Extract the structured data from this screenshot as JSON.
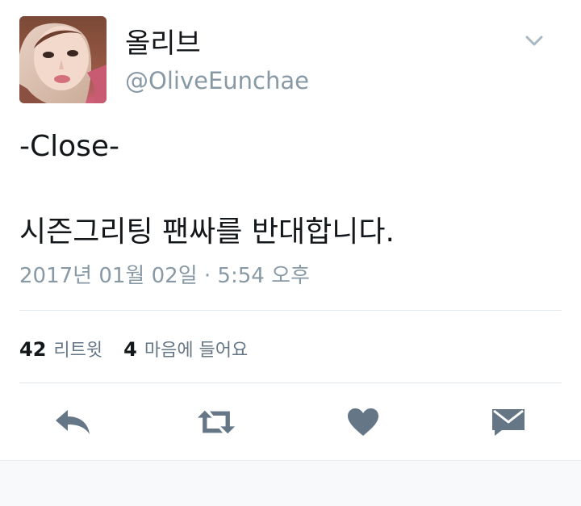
{
  "tweet": {
    "author": {
      "display_name": "올리브",
      "handle": "@OliveEunchae"
    },
    "text_lines": [
      "-Close-",
      "시즌그리팅 팬싸를 반대합니다."
    ],
    "timestamp": "2017년 01월 02일 · 5:54 오후",
    "stats": {
      "retweets_count": "42",
      "retweets_label": "리트윗",
      "likes_count": "4",
      "likes_label": "마음에 들어요"
    }
  },
  "icons": {
    "menu": "chevron-down-icon",
    "reply": "reply-icon",
    "retweet": "retweet-icon",
    "like": "heart-icon",
    "message": "envelope-icon"
  },
  "colors": {
    "text": "#14171a",
    "secondary": "#8899a6",
    "action_icon": "#657786",
    "divider": "#e1e8ed"
  }
}
